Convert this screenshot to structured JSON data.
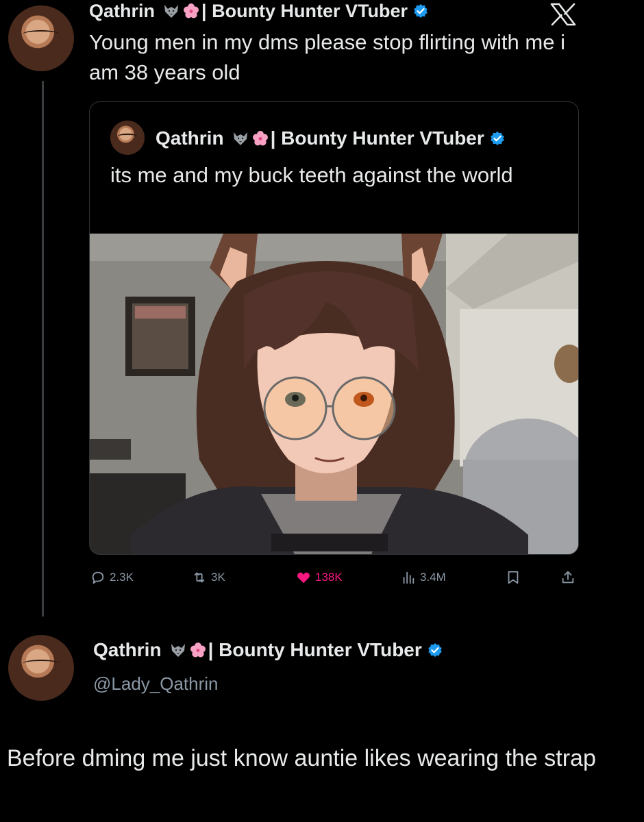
{
  "main_tweet": {
    "display_name": "Qathrin",
    "name_suffix": "| Bounty Hunter VTuber",
    "text": "Young men in my dms please stop flirting with me i am 38 years old"
  },
  "quote": {
    "display_name": "Qathrin",
    "name_suffix": "| Bounty Hunter VTuber",
    "text": "its me and my buck teeth against the world"
  },
  "actions": {
    "replies": "2.3K",
    "reposts": "3K",
    "likes": "138K",
    "views": "3.4M"
  },
  "reply": {
    "display_name": "Qathrin",
    "name_suffix": "| Bounty Hunter VTuber",
    "handle": "@Lady_Qathrin",
    "text": "Before dming me just know auntie likes wearing the strap"
  },
  "colors": {
    "background": "#000000",
    "text": "#e7e9ea",
    "muted": "#8b98a5",
    "verified": "#1d9bf0",
    "like": "#f91880"
  },
  "icons": [
    "x-logo-icon",
    "wolf-emoji-icon",
    "cherry-blossom-emoji-icon",
    "verified-badge-icon",
    "reply-icon",
    "repost-icon",
    "like-heart-icon",
    "views-icon",
    "bookmark-icon",
    "share-icon"
  ]
}
